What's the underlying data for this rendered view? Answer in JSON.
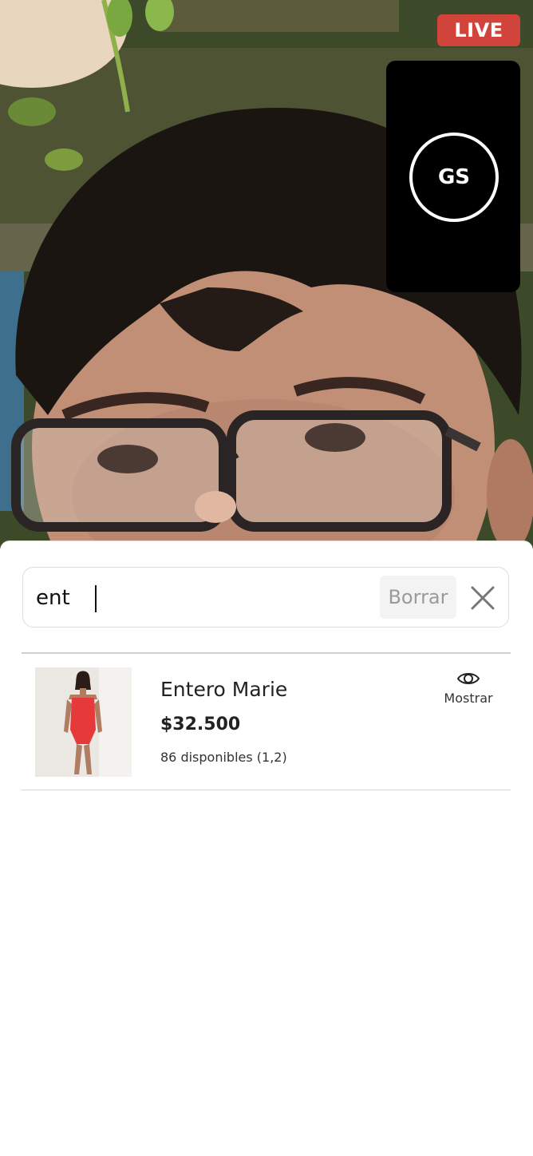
{
  "stream": {
    "live_label": "LIVE",
    "self_initials": "GS"
  },
  "search": {
    "value": "ent",
    "clear_label": "Borrar",
    "close_icon": "close-icon"
  },
  "products": [
    {
      "name": "Entero Marie",
      "price": "$32.500",
      "stock": "86 disponibles (1,2)",
      "action_label": "Mostrar",
      "action_icon": "eye-icon"
    }
  ],
  "colors": {
    "live": "#d0443c",
    "swimsuit": "#e5393a"
  }
}
